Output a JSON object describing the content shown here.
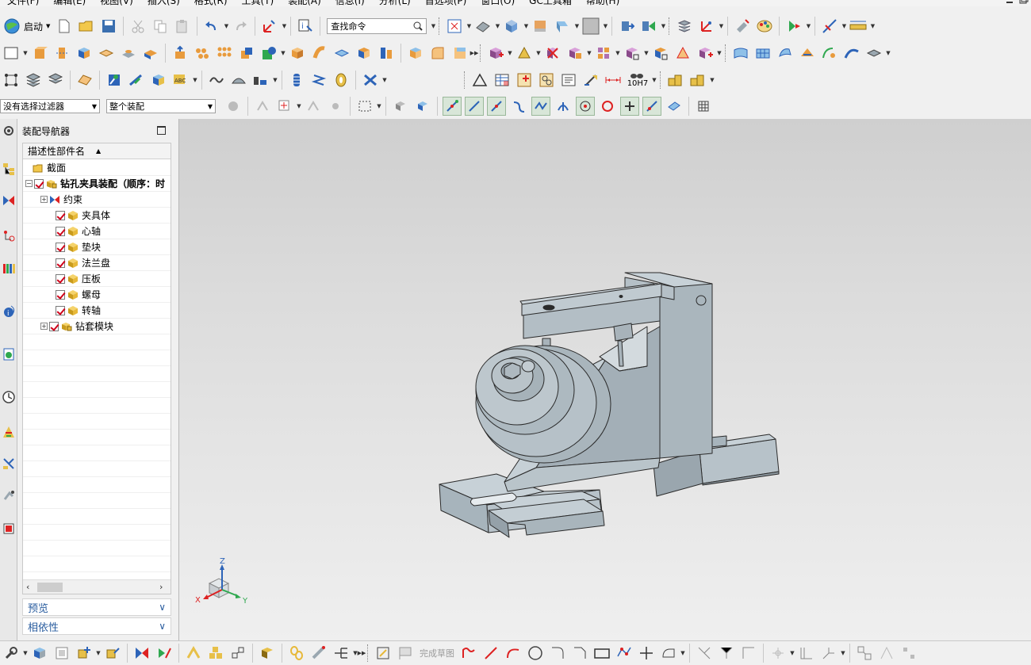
{
  "menubar": {
    "items": [
      "文件(F)",
      "编辑(E)",
      "视图(V)",
      "插入(S)",
      "格式(R)",
      "工具(T)",
      "装配(A)",
      "信息(I)",
      "分析(L)",
      "首选项(P)",
      "窗口(O)",
      "GC工具箱",
      "帮助(H)"
    ]
  },
  "toolbar": {
    "start_label": "启动",
    "search_placeholder": "查找命令",
    "dim_label": "10H7"
  },
  "selection_bar": {
    "filter_value": "没有选择过滤器",
    "scope_value": "整个装配"
  },
  "navigator": {
    "title": "装配导航器",
    "column_header": "描述性部件名",
    "rows": [
      {
        "label": "截面",
        "level": 1,
        "icon": "folder-icon"
      },
      {
        "label": "钻孔夹具装配（顺序：时",
        "level": 0,
        "icon": "assembly-icon",
        "bold": true,
        "checked": true
      },
      {
        "label": "约束",
        "level": 1,
        "icon": "constraint-icon"
      },
      {
        "label": "夹具体",
        "level": 2,
        "icon": "part-icon",
        "checked": true
      },
      {
        "label": "心轴",
        "level": 2,
        "icon": "part-icon",
        "checked": true
      },
      {
        "label": "垫块",
        "level": 2,
        "icon": "part-icon",
        "checked": true
      },
      {
        "label": "法兰盘",
        "level": 2,
        "icon": "part-icon",
        "checked": true
      },
      {
        "label": "压板",
        "level": 2,
        "icon": "part-icon",
        "checked": true
      },
      {
        "label": "螺母",
        "level": 2,
        "icon": "part-icon",
        "checked": true
      },
      {
        "label": "转轴",
        "level": 2,
        "icon": "part-icon",
        "checked": true
      },
      {
        "label": "钻套模块",
        "level": 1,
        "icon": "assembly-icon",
        "checked": true
      }
    ],
    "preview_label": "预览",
    "dependency_label": "相依性"
  },
  "triad": {
    "x": "X",
    "y": "Y",
    "z": "Z"
  },
  "bottom_toolbar": {
    "finish_sketch_label": "完成草图"
  },
  "colors": {
    "model_face": "#a7b4bc",
    "model_edge": "#2b2b2b",
    "check_red": "#d0001a",
    "link_blue": "#2a5d9f"
  }
}
